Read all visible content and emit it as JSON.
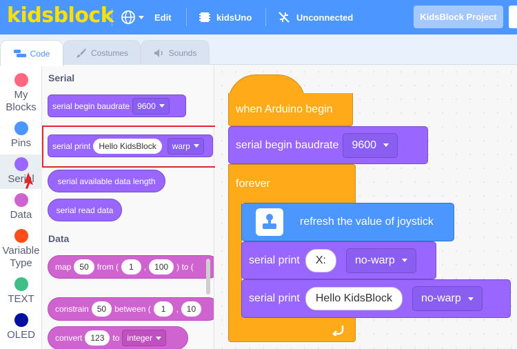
{
  "app": {
    "logo": "kidsblock"
  },
  "menubar": {
    "edit_label": "Edit",
    "board_label": "kidsUno",
    "connection_label": "Unconnected",
    "project_label": "KidsBlock Project"
  },
  "tabs": {
    "code": "Code",
    "costumes": "Costumes",
    "sounds": "Sounds"
  },
  "categories": [
    {
      "label": "My Blocks",
      "color": "#ff6680"
    },
    {
      "label": "Pins",
      "color": "#4c97ff"
    },
    {
      "label": "Serial",
      "color": "#9966ff"
    },
    {
      "label": "Data",
      "color": "#cf63cf"
    },
    {
      "label": "Variable Type",
      "color": "#ff4d1a"
    },
    {
      "label": "TEXT",
      "color": "#3fbf87"
    },
    {
      "label": "OLED",
      "color": "#0010a0"
    }
  ],
  "palette": {
    "serial_heading": "Serial",
    "serial_begin": {
      "label": "serial begin baudrate",
      "value": "9600"
    },
    "serial_print": {
      "label": "serial print",
      "text": "Hello KidsBlock",
      "mode": "warp"
    },
    "serial_available": "serial available data length",
    "serial_read": "serial read data",
    "data_heading": "Data",
    "map": {
      "label": "map",
      "value": "50",
      "from": "from (",
      "a": "1",
      "comma": ",",
      "b": "100",
      "to": ") to ("
    },
    "constrain": {
      "label": "constrain",
      "value": "50",
      "between": "between (",
      "a": "1",
      "comma": ",",
      "b": "10"
    },
    "convert": {
      "label": "convert",
      "value": "123",
      "to": "to",
      "type": "integer"
    }
  },
  "script": {
    "hat": "when Arduino begin",
    "serial_begin": {
      "label": "serial begin baudrate",
      "value": "9600"
    },
    "forever": "forever",
    "joystick": "refresh the value of joystick",
    "print1": {
      "label": "serial print",
      "text": "X:",
      "mode": "no-warp"
    },
    "print2": {
      "label": "serial print",
      "text": "Hello KidsBlock",
      "mode": "no-warp"
    }
  }
}
